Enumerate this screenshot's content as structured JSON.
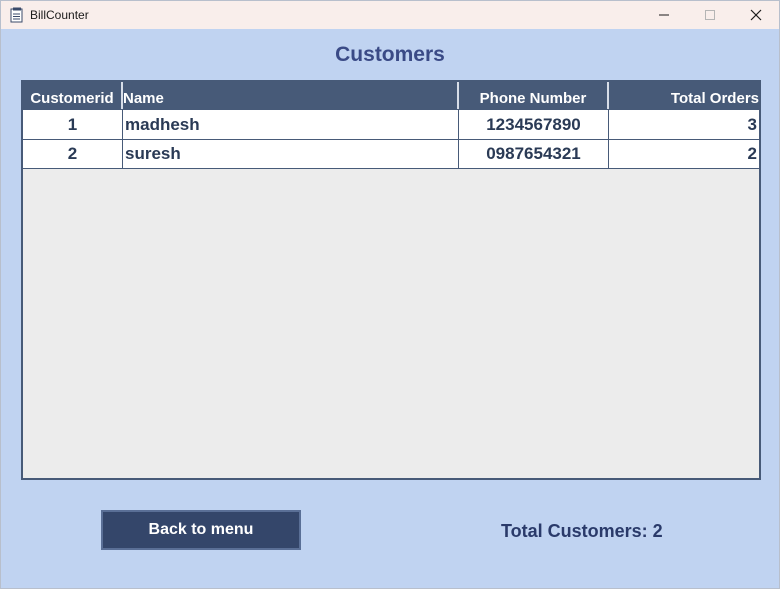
{
  "window": {
    "title": "BillCounter",
    "icon": "document-icon",
    "controls": [
      "minimize-icon",
      "maximize-icon",
      "close-icon"
    ]
  },
  "page": {
    "title": "Customers"
  },
  "table": {
    "columns": [
      "Customerid",
      "Name",
      "Phone Number",
      "Total Orders"
    ],
    "rows": [
      {
        "id": "1",
        "name": "madhesh",
        "phone": "1234567890",
        "orders": "3"
      },
      {
        "id": "2",
        "name": "suresh",
        "phone": "0987654321",
        "orders": "2"
      }
    ]
  },
  "footer": {
    "back_label": "Back to menu",
    "total_label": "Total Customers: 2"
  },
  "colors": {
    "background": "#c0d3f1",
    "header": "#475a78",
    "button": "#34466a",
    "title": "#3a4a86"
  }
}
